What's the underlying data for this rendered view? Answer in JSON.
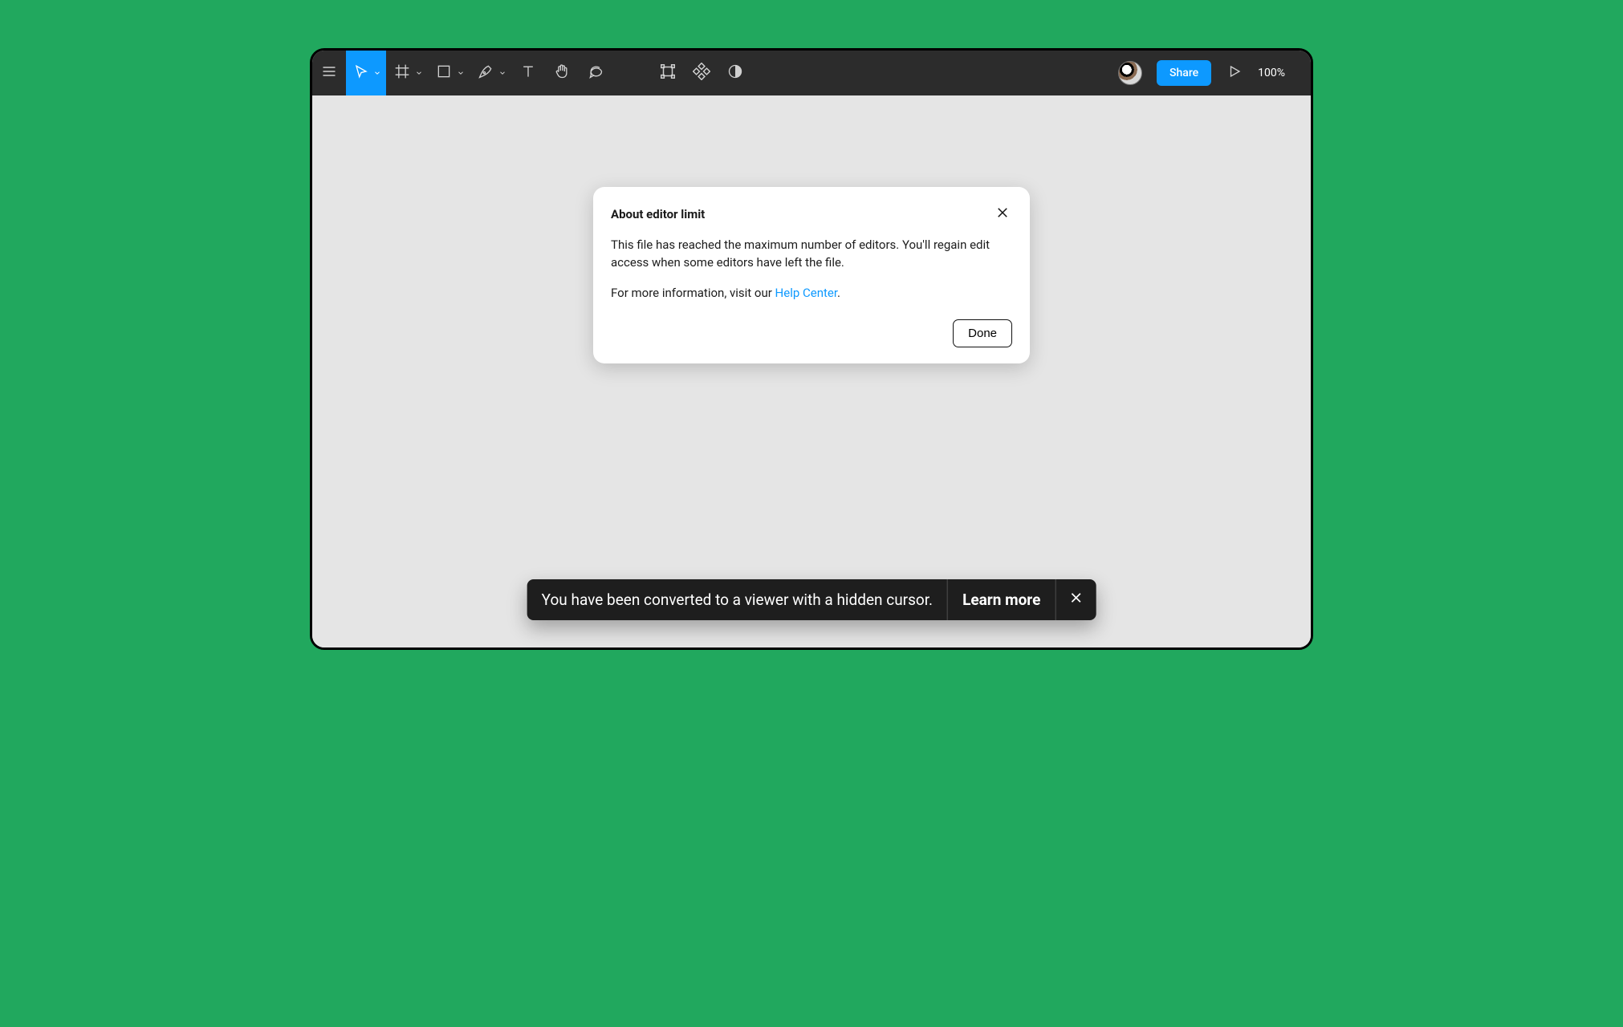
{
  "toolbar": {
    "share_label": "Share",
    "zoom_label": "100%"
  },
  "modal": {
    "title": "About editor limit",
    "body_line1": "This file has reached the maximum number of editors. You'll regain edit access when some editors have left the file.",
    "body_line2_prefix": "For more information, visit our ",
    "help_link_text": "Help Center",
    "body_line2_suffix": ".",
    "done_label": "Done"
  },
  "toast": {
    "message": "You have been converted to a viewer with a hidden cursor.",
    "learn_more": "Learn more"
  },
  "colors": {
    "page_bg": "#21a85e",
    "toolbar_bg": "#2c2c2c",
    "accent": "#0d99ff",
    "canvas_bg": "#e5e5e5"
  }
}
